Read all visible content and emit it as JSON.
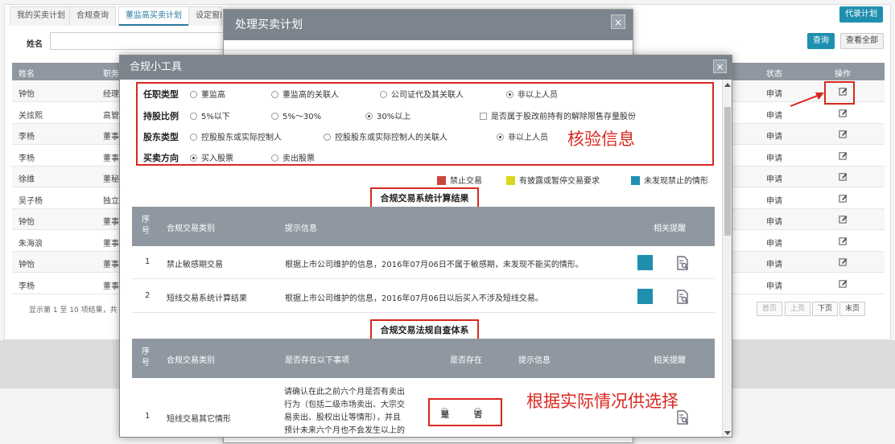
{
  "tabs": [
    "我的买卖计划",
    "合规查询",
    "董监高买卖计划",
    "设定窗口"
  ],
  "top_right_button": "代录计划",
  "search": {
    "label": "姓名",
    "query_button": "查询",
    "view_all_button": "查看全部"
  },
  "bg_table": {
    "headers": {
      "name": "姓名",
      "position": "职务",
      "status": "状态",
      "action": "操作"
    },
    "rows": [
      {
        "name": "钟怡",
        "position": "经理",
        "status": "申请"
      },
      {
        "name": "关炫熙",
        "position": "高管",
        "status": "申请"
      },
      {
        "name": "李杨",
        "position": "董事",
        "status": "申请"
      },
      {
        "name": "李杨",
        "position": "董事",
        "status": "申请"
      },
      {
        "name": "徐维",
        "position": "董秘",
        "status": "申请"
      },
      {
        "name": "吴子杨",
        "position": "独立",
        "status": "申请"
      },
      {
        "name": "钟怡",
        "position": "董事",
        "status": "申请"
      },
      {
        "name": "朱海浪",
        "position": "董事",
        "status": "申请"
      },
      {
        "name": "钟怡",
        "position": "董事",
        "status": "申请"
      },
      {
        "name": "李杨",
        "position": "董事",
        "status": "申请"
      }
    ],
    "footer_text": "显示第 1 至 10 项结果，共",
    "pager": [
      "首页",
      "上页",
      "下页",
      "末页"
    ]
  },
  "dialog1": {
    "title": "处理买卖计划",
    "close": "×"
  },
  "dialog2": {
    "title": "合规小工具",
    "close": "×",
    "form": {
      "role": {
        "label": "任职类型",
        "options": [
          "董监高",
          "董监高的关联人",
          "公司证代及其关联人",
          "非以上人员"
        ],
        "selected": 3
      },
      "holding": {
        "label": "持股比例",
        "options": [
          "5%以下",
          "5%～30%",
          "30%以上"
        ],
        "selected": 2,
        "checkbox": "是否属于股改前持有的解除限售存量股份"
      },
      "shareholder": {
        "label": "股东类型",
        "options": [
          "控股股东或实际控制人",
          "控股股东或实际控制人的关联人",
          "非以上人员"
        ],
        "selected": 2
      },
      "direction": {
        "label": "买卖方向",
        "options": [
          "买入股票",
          "卖出股票"
        ],
        "selected": 0
      }
    },
    "legend": [
      {
        "label": "禁止交易",
        "color": "#c8463c"
      },
      {
        "label": "有披露或暂停交易要求",
        "color": "#d8d81e"
      },
      {
        "label": "未发现禁止的情形",
        "color": "#1f8fb0"
      }
    ],
    "section1": {
      "title": "合规交易系统计算结果",
      "headers": {
        "no": "序号",
        "type": "合规交易类别",
        "info": "提示信息",
        "remind": "相关提醒"
      },
      "rows": [
        {
          "no": "1",
          "type": "禁止敏感期交易",
          "info": "根据上市公司维护的信息，2016年07月06日不属于敏感期，未发现不能买的情形。"
        },
        {
          "no": "2",
          "type": "短线交易系统计算结果",
          "info": "根据上市公司维护的信息，2016年07月06日以后买入不涉及短线交易。"
        }
      ]
    },
    "section2": {
      "title": "合规交易法规自查体系",
      "headers": {
        "no": "序号",
        "type": "合规交易类别",
        "question": "是否存在以下事项",
        "exists": "是否存在",
        "info": "提示信息",
        "remind": "相关提醒"
      },
      "rows": [
        {
          "no": "1",
          "type": "短线交易其它情形",
          "question_lines": [
            "请确认在此之前六个月是否有卖出",
            "行为（包括二级市场卖出、大宗交",
            "易卖出、股权出让等情形），并且",
            "预计未来六个月也不会发生以上的"
          ],
          "yes": "是",
          "no_label": "否"
        }
      ]
    }
  },
  "annotations": {
    "verify": "核验信息",
    "choose": "根据实际情况供选择"
  }
}
